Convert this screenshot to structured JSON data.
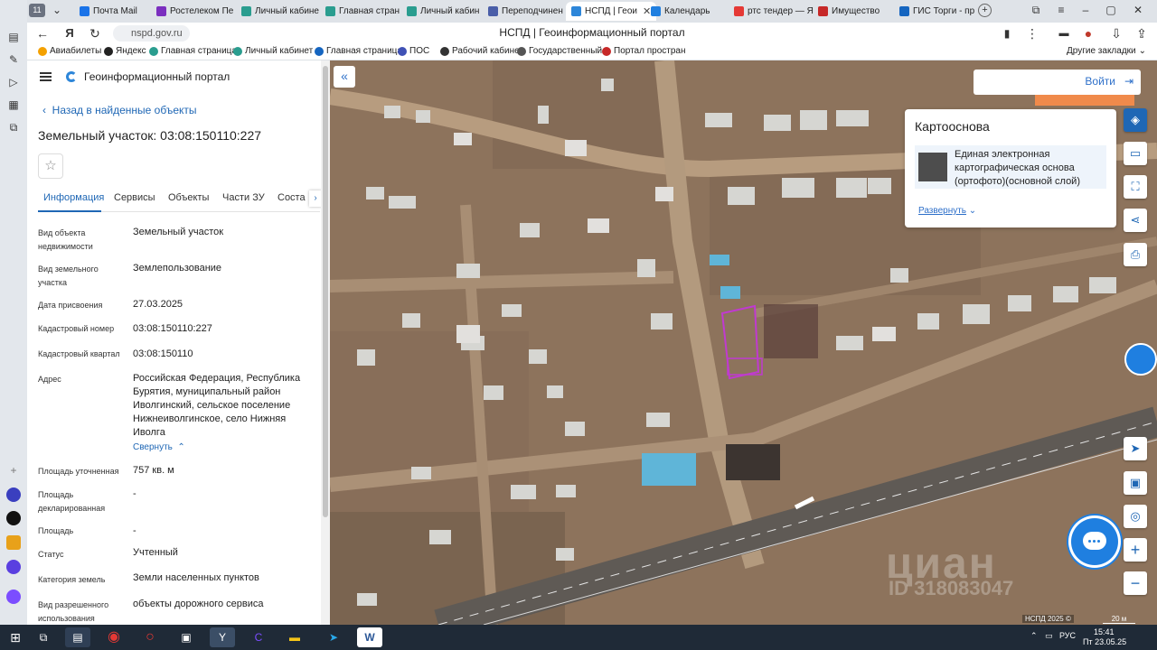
{
  "browser": {
    "tab_count_badge": "11",
    "tabs": [
      {
        "label": "Почта Mail",
        "color": "#1a73e8"
      },
      {
        "label": "Ростелеком Пе",
        "color": "#7b2fbf"
      },
      {
        "label": "Личный кабине",
        "color": "#2a9d8f"
      },
      {
        "label": "Главная стран",
        "color": "#2a9d8f"
      },
      {
        "label": "Личный кабин",
        "color": "#2a9d8f"
      },
      {
        "label": "Переподчинен",
        "color": "#4a5ea8"
      },
      {
        "label": "НСПД | Геои",
        "color": "#2d86d9"
      },
      {
        "label": "Календарь",
        "color": "#1f7fe0"
      },
      {
        "label": "ртс тендер — Я",
        "color": "#e53935"
      },
      {
        "label": "Имущество",
        "color": "#c62828"
      },
      {
        "label": "ГИС Торги - пр",
        "color": "#1565c0"
      }
    ],
    "url": "nspd.gov.ru",
    "page_title": "НСПД | Геоинформационный портал",
    "bookmarks": [
      {
        "label": "Авиабилеты",
        "color": "#f4a100"
      },
      {
        "label": "Яндекс",
        "color": "#222222"
      },
      {
        "label": "Главная страница",
        "color": "#2a9d8f"
      },
      {
        "label": "Личный кабинет",
        "color": "#2a9d8f"
      },
      {
        "label": "Главная страница",
        "color": "#1565c0"
      },
      {
        "label": "ПОС",
        "color": "#3f51b5"
      },
      {
        "label": "Рабочий кабинет",
        "color": "#333333"
      },
      {
        "label": "Государственный",
        "color": "#555555"
      },
      {
        "label": "Портал простран",
        "color": "#c62828"
      }
    ],
    "other_bookmarks": "Другие закладки"
  },
  "panel": {
    "portal_name": "Геоинформационный портал",
    "back_link": "Назад в найденные объекты",
    "title": "Земельный участок: 03:08:150110:227",
    "tabs": [
      "Информация",
      "Сервисы",
      "Объекты",
      "Части ЗУ",
      "Соста"
    ],
    "fields": [
      {
        "label": "Вид объекта недвижимости",
        "value": "Земельный участок"
      },
      {
        "label": "Вид земельного участка",
        "value": "Землепользование"
      },
      {
        "label": "Дата присвоения",
        "value": "27.03.2025"
      },
      {
        "label": "Кадастровый номер",
        "value": "03:08:150110:227"
      },
      {
        "label": "Кадастровый квартал",
        "value": "03:08:150110"
      },
      {
        "label": "Адрес",
        "value": "Российская Федерация, Республика Бурятия, муниципальный район Иволгинский, сельское поселение Нижнеиволгинское, село Нижняя Иволга"
      },
      {
        "label": "Площадь уточненная",
        "value": "757 кв. м"
      },
      {
        "label": "Площадь декларированная",
        "value": "-"
      },
      {
        "label": "Площадь",
        "value": "-"
      },
      {
        "label": "Статус",
        "value": "Учтенный"
      },
      {
        "label": "Категория земель",
        "value": "Земли населенных пунктов"
      },
      {
        "label": "Вид разрешенного использования",
        "value": "объекты дорожного сервиса"
      }
    ],
    "collapse_link": "Свернуть"
  },
  "map": {
    "login_label": "Войти",
    "basemap_title": "Картооснова",
    "basemap_name": "Единая электронная картографическая основа (ортофото)(основной слой)",
    "expand_link": "Развернуть",
    "watermark": "циан",
    "watermark_id": "ID 318083047",
    "attribution": "НСПД 2025 ©",
    "scale": "20 м",
    "parcel_color": "#c03ad0"
  },
  "taskbar": {
    "lang": "РУС",
    "time": "15:41",
    "date": "Пт 23.05.25"
  }
}
